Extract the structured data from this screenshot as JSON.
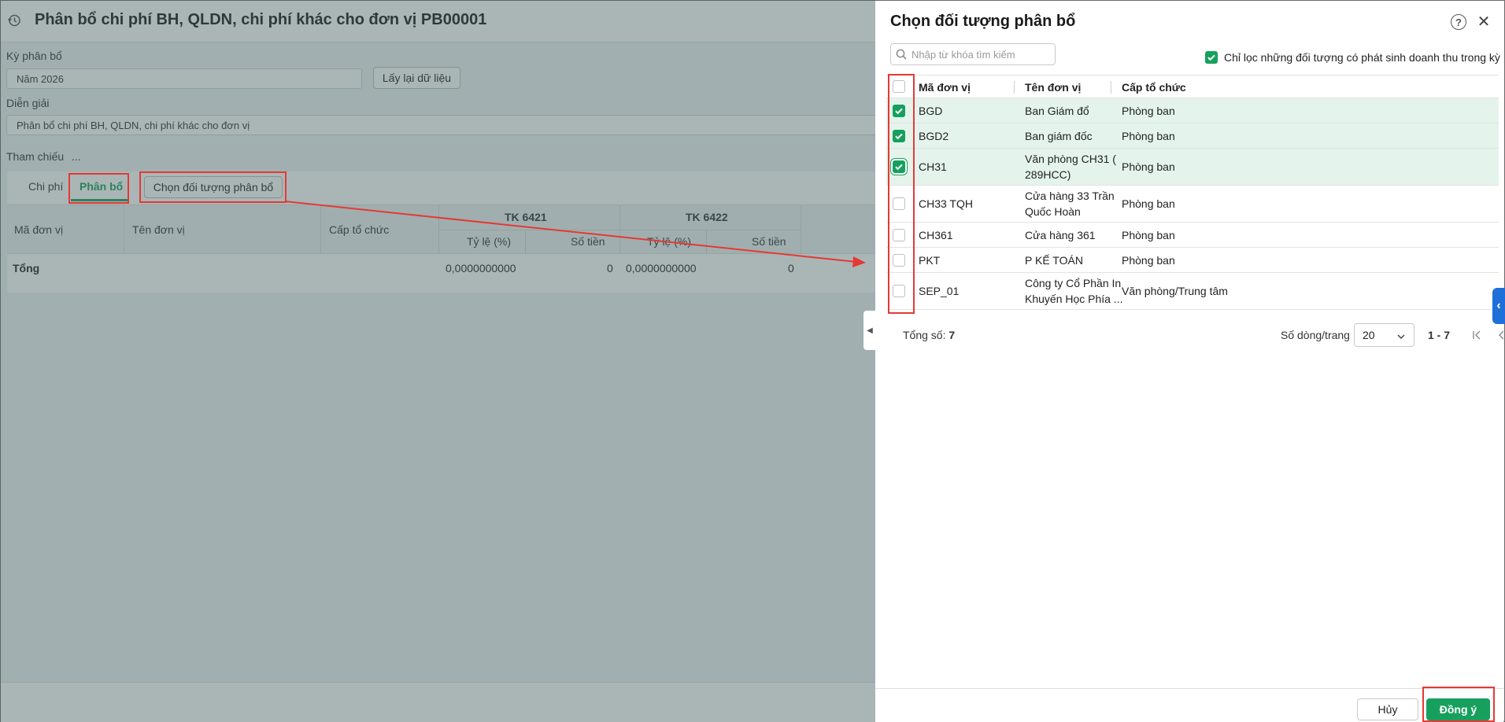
{
  "background": {
    "title": "Phân bổ chi phí BH, QLDN, chi phí khác cho đơn vị PB00001",
    "period_label": "Kỳ phân bổ",
    "period_value": "Năm 2026",
    "reload_button": "Lấy lại dữ liệu",
    "description_label": "Diễn giải",
    "description_value": "Phân bổ chi phí BH, QLDN, chi phí khác cho đơn vị",
    "reference_label": "Tham chiếu",
    "reference_value": "...",
    "tabs": [
      "Chi phí",
      "Phân bổ"
    ],
    "choose_button": "Chọn đối tượng phân bổ",
    "grid": {
      "col_code": "Mã đơn vị",
      "col_name": "Tên đơn vị",
      "col_level": "Cấp tổ chức",
      "group1": "TK 6421",
      "group2": "TK 6422",
      "sub_ratio": "Tỷ lệ (%)",
      "sub_amount": "Số tiền",
      "total_label": "Tổng",
      "total_ratio1": "0,0000000000",
      "total_amount1": "0",
      "total_ratio2": "0,0000000000",
      "total_amount2": "0"
    }
  },
  "panel": {
    "title": "Chọn đối tượng phân bổ",
    "search_placeholder": "Nhập từ khóa tìm kiếm",
    "filter_label": "Chỉ lọc những đối tượng có phát sinh doanh thu trong kỳ",
    "filter_checked": true,
    "columns": {
      "code": "Mã đơn vị",
      "name": "Tên đơn vị",
      "level": "Cấp tổ chức"
    },
    "rows": [
      {
        "code": "BGD",
        "name": "Ban Giám đổ",
        "level": "Phòng ban",
        "checked": true
      },
      {
        "code": "BGD2",
        "name": "Ban giám đốc",
        "level": "Phòng ban",
        "checked": true
      },
      {
        "code": "CH31",
        "name": "Văn phòng CH31 ( 289HCC)",
        "level": "Phòng ban",
        "checked": true
      },
      {
        "code": "CH33 TQH",
        "name": "Cửa hàng 33 Trần Quốc Hoàn",
        "level": "Phòng ban",
        "checked": false
      },
      {
        "code": "CH361",
        "name": "Cửa hàng 361",
        "level": "Phòng ban",
        "checked": false
      },
      {
        "code": "PKT",
        "name": "P KẾ TOÁN",
        "level": "Phòng ban",
        "checked": false
      },
      {
        "code": "SEP_01",
        "name": "Công ty Cổ Phần In Khuyến Học Phía ...",
        "level": "Văn phòng/Trung tâm",
        "checked": false
      }
    ],
    "pager": {
      "total_label": "Tổng số:",
      "total_value": "7",
      "rows_per_page_label": "Số dòng/trang",
      "rows_per_page": "20",
      "range": "1 - 7"
    },
    "cancel_button": "Hủy",
    "ok_button": "Đồng ý"
  },
  "colors": {
    "accent_green": "#17a05d",
    "annotation_red": "#e53935",
    "handle_blue": "#1e6fd9"
  },
  "icons": [
    "history-icon",
    "help-icon",
    "close-icon",
    "search-icon",
    "check-icon",
    "chevron-down-icon",
    "first-page-icon",
    "prev-page-icon",
    "next-page-icon",
    "last-page-icon",
    "collapse-left-icon",
    "expand-left-icon"
  ]
}
